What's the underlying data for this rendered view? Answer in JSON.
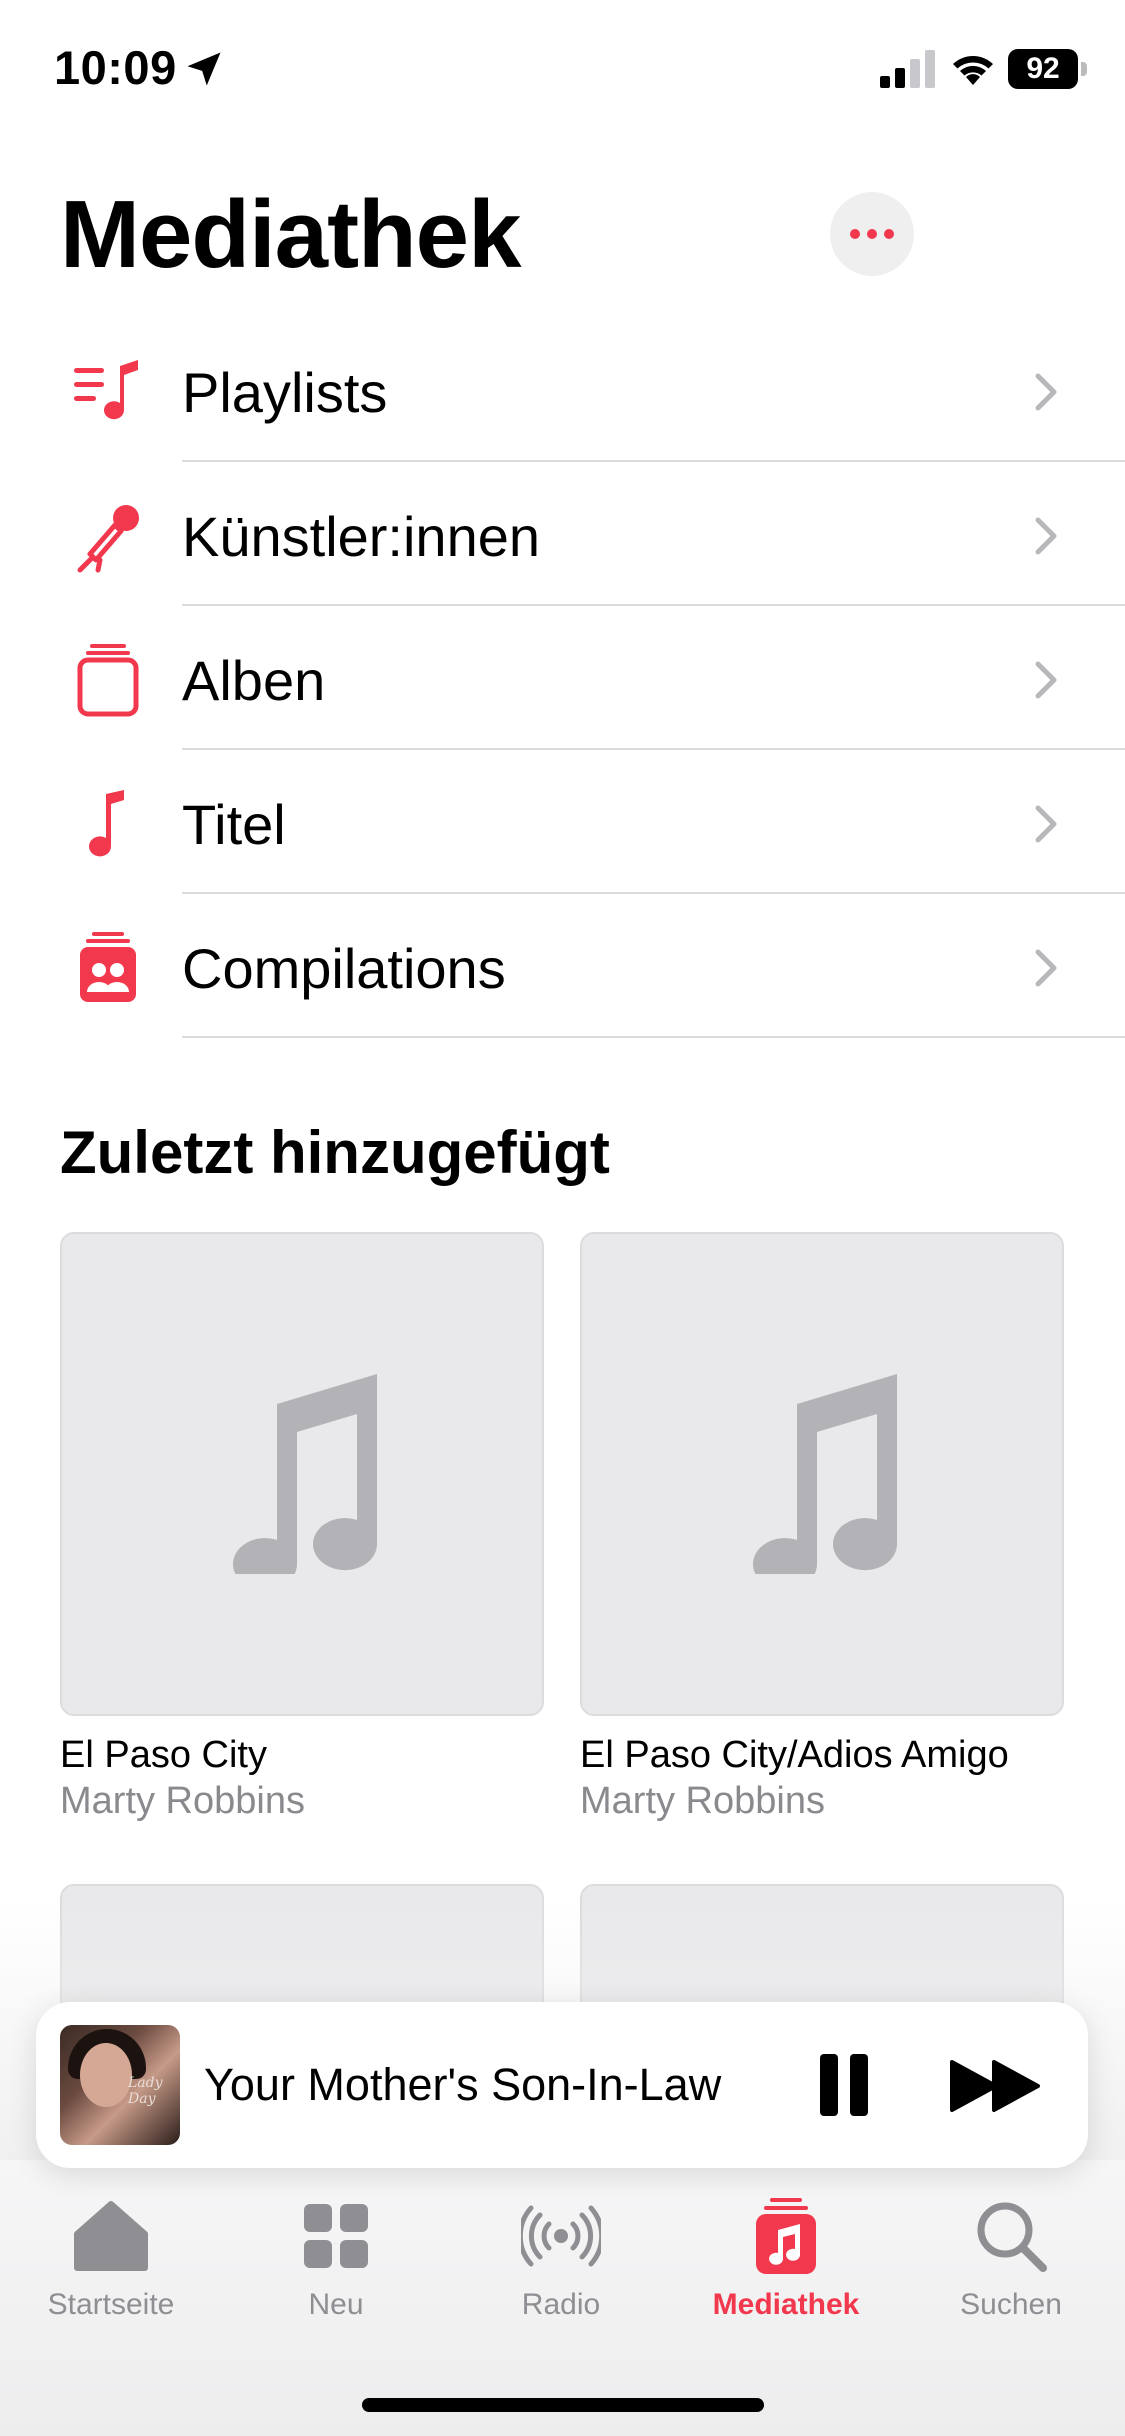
{
  "status_bar": {
    "time": "10:09",
    "battery": "92",
    "icons": [
      "location-arrow-icon",
      "cellular-signal-icon",
      "wifi-icon",
      "battery-icon"
    ]
  },
  "header": {
    "title": "Mediathek",
    "more_icon": "ellipsis-icon"
  },
  "library_items": [
    {
      "label": "Playlists",
      "icon": "playlist-icon"
    },
    {
      "label": "Künstler:innen",
      "icon": "microphone-icon"
    },
    {
      "label": "Alben",
      "icon": "album-stack-icon"
    },
    {
      "label": "Titel",
      "icon": "music-note-icon"
    },
    {
      "label": "Compilations",
      "icon": "compilations-icon"
    }
  ],
  "recently_added": {
    "title": "Zuletzt hinzugefügt",
    "albums": [
      {
        "title": "El Paso City",
        "artist": "Marty Robbins"
      },
      {
        "title": "El Paso City/Adios Amigo",
        "artist": "Marty Robbins"
      }
    ]
  },
  "mini_player": {
    "track": "Your Mother's Son-In-Law",
    "artwork_signature": "Lady Day"
  },
  "tabs": [
    {
      "label": "Startseite",
      "icon": "home-icon",
      "active": false
    },
    {
      "label": "Neu",
      "icon": "grid-icon",
      "active": false
    },
    {
      "label": "Radio",
      "icon": "radio-broadcast-icon",
      "active": false
    },
    {
      "label": "Mediathek",
      "icon": "library-icon",
      "active": true
    },
    {
      "label": "Suchen",
      "icon": "search-icon",
      "active": false
    }
  ],
  "colors": {
    "accent": "#f2384d",
    "secondary_text": "#8a8a8e",
    "placeholder_art": "#e9e9eb",
    "placeholder_note": "#b3b3b7"
  }
}
